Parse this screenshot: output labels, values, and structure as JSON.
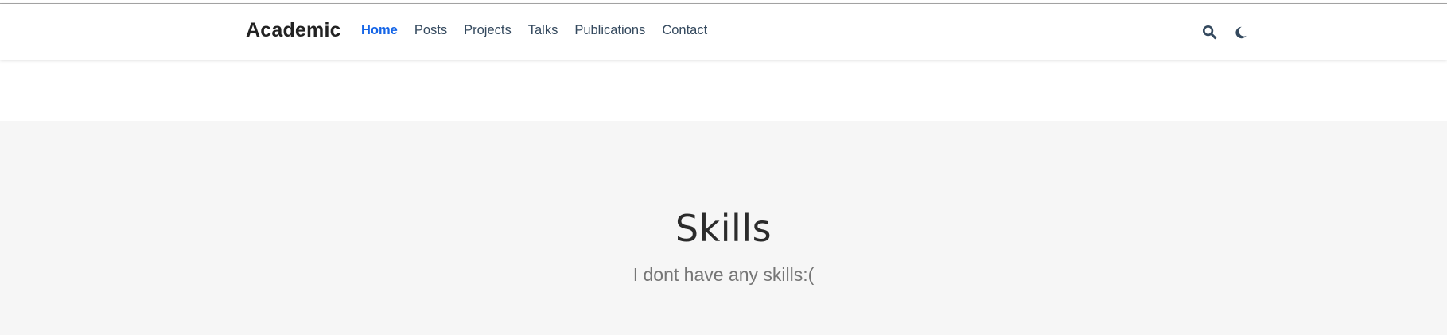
{
  "navbar": {
    "brand": "Academic",
    "links": [
      {
        "label": "Home",
        "active": true
      },
      {
        "label": "Posts",
        "active": false
      },
      {
        "label": "Projects",
        "active": false
      },
      {
        "label": "Talks",
        "active": false
      },
      {
        "label": "Publications",
        "active": false
      },
      {
        "label": "Contact",
        "active": false
      }
    ],
    "icons": [
      "search-icon",
      "moon-icon"
    ]
  },
  "skills": {
    "title": "Skills",
    "subtitle": "I dont have any skills:("
  },
  "colors": {
    "accent": "#1565e7",
    "nav_text": "#34495e",
    "section_bg": "#f6f6f6",
    "title_text": "#2b2b2b",
    "subtitle_text": "#767676"
  }
}
